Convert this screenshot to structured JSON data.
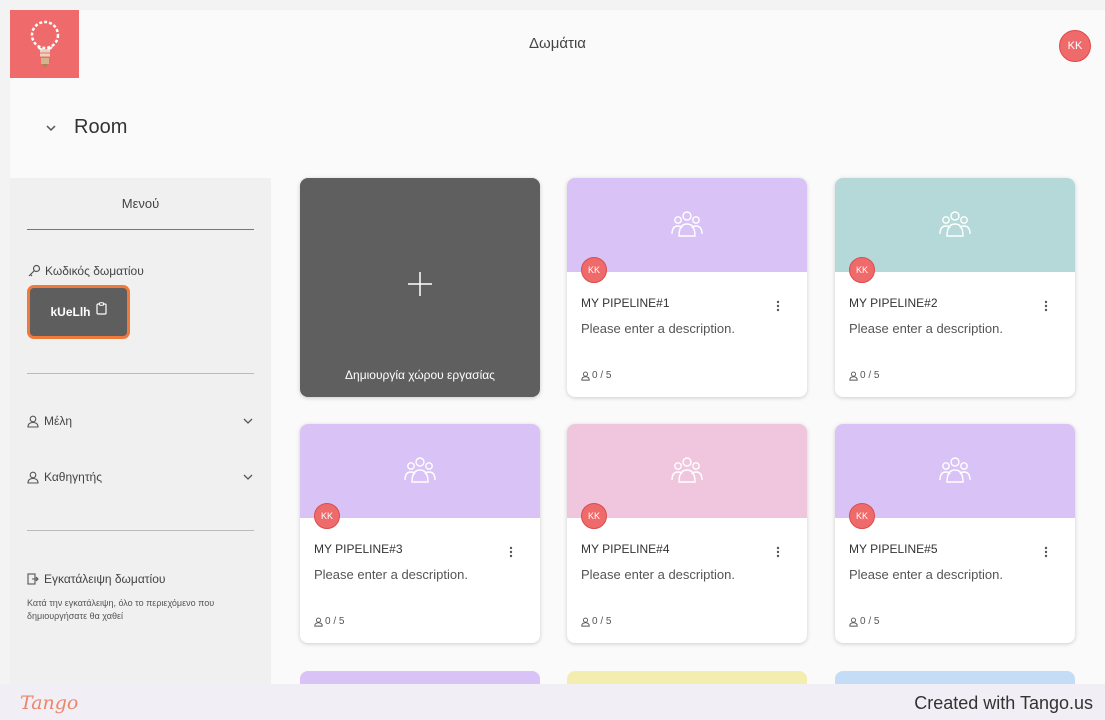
{
  "header": {
    "title": "Δωμάτια",
    "avatar": "KK"
  },
  "room": {
    "title": "Room"
  },
  "sidebar": {
    "menu_title": "Μενού",
    "code_label": "Κωδικός δωματίου",
    "code_value": "kUeLlh",
    "members_label": "Μέλη",
    "teacher_label": "Καθηγητής",
    "leave_label": "Εγκατάλειψη δωματίου",
    "leave_note": "Κατά την εγκατάλειψη, όλο το περιεχόμενο που δημιουργήσατε θα χαθεί"
  },
  "create_card": {
    "label": "Δημιουργία χώρου εργασίας"
  },
  "workspaces": [
    {
      "avatar": "KK",
      "name": "MY PIPELINE#1",
      "description": "Please enter a description.",
      "members": "0 / 5",
      "color": "#d9c2f5"
    },
    {
      "avatar": "KK",
      "name": "MY PIPELINE#2",
      "description": "Please enter a description.",
      "members": "0 / 5",
      "color": "#b5d8d8"
    },
    {
      "avatar": "KK",
      "name": "MY PIPELINE#3",
      "description": "Please enter a description.",
      "members": "0 / 5",
      "color": "#d9c2f5"
    },
    {
      "avatar": "KK",
      "name": "MY PIPELINE#4",
      "description": "Please enter a description.",
      "members": "0 / 5",
      "color": "#efc6dd"
    },
    {
      "avatar": "KK",
      "name": "MY PIPELINE#5",
      "description": "Please enter a description.",
      "members": "0 / 5",
      "color": "#d9c2f5"
    }
  ],
  "peek_colors": [
    "#d9c2f5",
    "#f3eeb0",
    "#c4dcf5"
  ],
  "footer": {
    "logo": "Tango",
    "credit": "Created with Tango.us"
  },
  "colors": {
    "accent": "#ef6b6b",
    "highlight": "#f07a3c",
    "create_card": "#5f5f5f"
  }
}
